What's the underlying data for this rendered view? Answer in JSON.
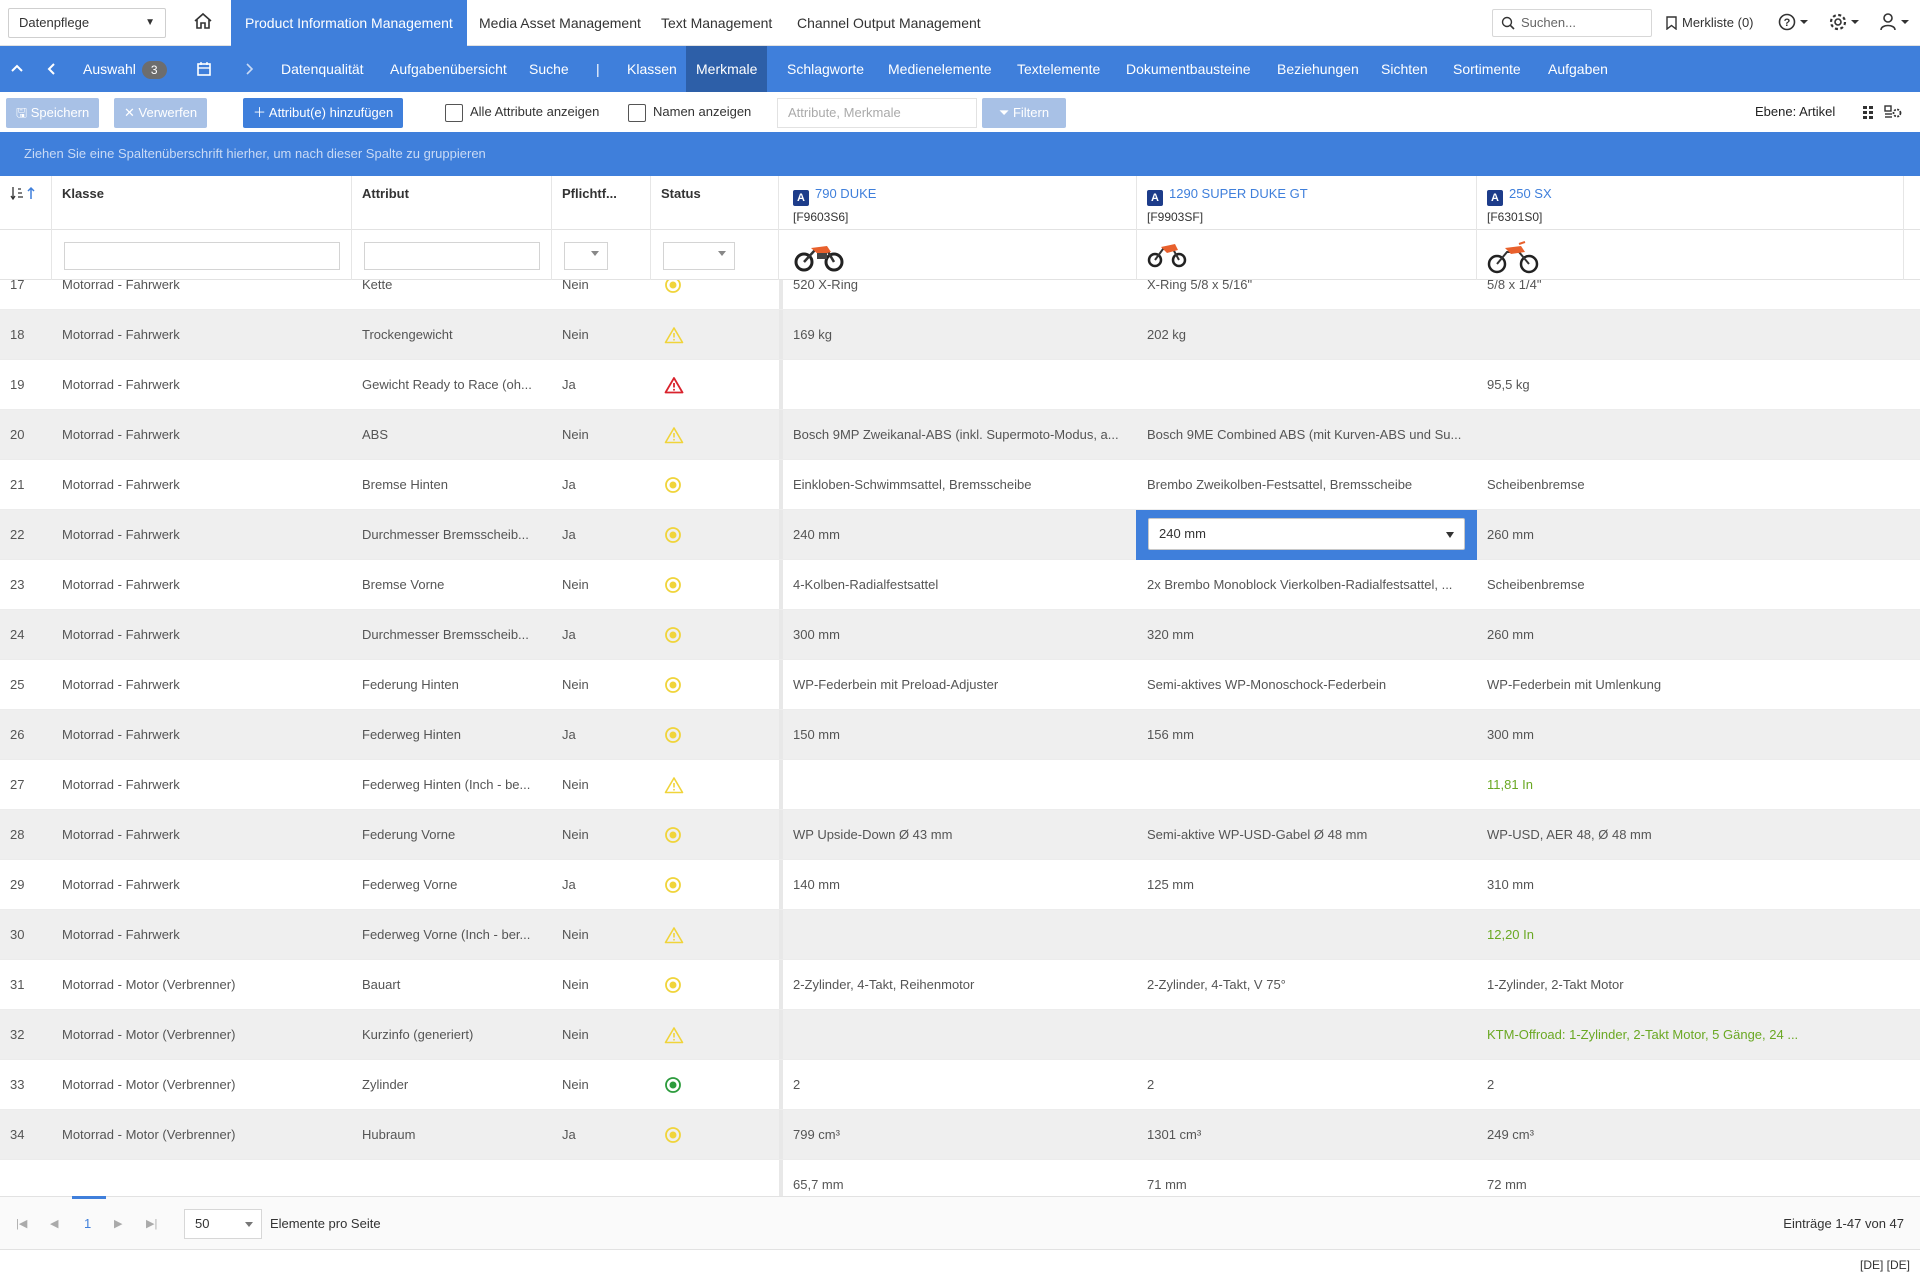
{
  "topbar": {
    "context": "Datenpflege",
    "apps": [
      {
        "label": "Product Information Management",
        "active": true
      },
      {
        "label": "Media Asset Management",
        "active": false
      },
      {
        "label": "Text Management",
        "active": false
      },
      {
        "label": "Channel Output Management",
        "active": false
      }
    ],
    "search_placeholder": "Suchen...",
    "merkliste": "Merkliste (0)"
  },
  "nav": {
    "auswahl": "Auswahl",
    "auswahl_count": "3",
    "items": [
      "Datenqualität",
      "Aufgabenübersicht",
      "Suche",
      "|",
      "Klassen",
      "Merkmale",
      "Schlagworte",
      "Medienelemente",
      "Textelemente",
      "Dokumentbausteine",
      "Beziehungen",
      "Sichten",
      "Sortimente",
      "Aufgaben"
    ],
    "active": "Merkmale"
  },
  "toolbar": {
    "save": "Speichern",
    "discard": "Verwerfen",
    "add_attr": "Attribut(e) hinzufügen",
    "show_all": "Alle Attribute anzeigen",
    "show_names": "Namen anzeigen",
    "filter_placeholder": "Attribute, Merkmale",
    "filter_btn": "Filtern",
    "ebene": "Ebene: Artikel"
  },
  "groupbar": "Ziehen Sie eine Spaltenüberschrift hierher, um nach dieser Spalte zu gruppieren",
  "grid": {
    "headers": {
      "klasse": "Klasse",
      "attribut": "Attribut",
      "pflicht": "Pflichtf...",
      "status": "Status"
    },
    "products": [
      {
        "badge": "A",
        "name": "790 DUKE",
        "code": "[F9603S6]"
      },
      {
        "badge": "A",
        "name": "1290 SUPER DUKE GT",
        "code": "[F9903SF]"
      },
      {
        "badge": "A",
        "name": "250 SX",
        "code": "[F6301S0]"
      }
    ],
    "rows": [
      {
        "n": "17",
        "klasse": "Motorrad - Fahrwerk",
        "attr": "Kette",
        "pf": "Nein",
        "status": "circle-yellow",
        "v1": "520 X-Ring",
        "v2": "X-Ring 5/8 x 5/16\"",
        "v3": "5/8 x 1/4\""
      },
      {
        "n": "18",
        "klasse": "Motorrad - Fahrwerk",
        "attr": "Trockengewicht",
        "pf": "Nein",
        "status": "warn-yellow",
        "v1": "169 kg",
        "v2": "202 kg",
        "v3": ""
      },
      {
        "n": "19",
        "klasse": "Motorrad - Fahrwerk",
        "attr": "Gewicht Ready to Race (oh...",
        "pf": "Ja",
        "status": "warn-red",
        "v1": "",
        "v2": "",
        "v3": "95,5 kg"
      },
      {
        "n": "20",
        "klasse": "Motorrad - Fahrwerk",
        "attr": "ABS",
        "pf": "Nein",
        "status": "warn-yellow",
        "v1": "Bosch 9MP Zweikanal-ABS (inkl. Supermoto-Modus, a...",
        "v2": "Bosch 9ME Combined ABS (mit Kurven-ABS und Su...",
        "v3": ""
      },
      {
        "n": "21",
        "klasse": "Motorrad - Fahrwerk",
        "attr": "Bremse Hinten",
        "pf": "Ja",
        "status": "circle-yellow",
        "v1": "Einkloben-Schwimmsattel, Bremsscheibe",
        "v2": "Brembo Zweikolben-Festsattel, Bremsscheibe",
        "v3": "Scheibenbremse"
      },
      {
        "n": "22",
        "klasse": "Motorrad - Fahrwerk",
        "attr": "Durchmesser Bremsscheib...",
        "pf": "Ja",
        "status": "circle-yellow",
        "v1": "240 mm",
        "v2": "240 mm",
        "v3": "260 mm",
        "editing": true
      },
      {
        "n": "23",
        "klasse": "Motorrad - Fahrwerk",
        "attr": "Bremse Vorne",
        "pf": "Nein",
        "status": "circle-yellow",
        "v1": "4-Kolben-Radialfestsattel",
        "v2": "2x Brembo Monoblock Vierkolben-Radialfestsattel, ...",
        "v3": "Scheibenbremse"
      },
      {
        "n": "24",
        "klasse": "Motorrad - Fahrwerk",
        "attr": "Durchmesser Bremsscheib...",
        "pf": "Ja",
        "status": "circle-yellow",
        "v1": "300 mm",
        "v2": "320 mm",
        "v3": "260 mm"
      },
      {
        "n": "25",
        "klasse": "Motorrad - Fahrwerk",
        "attr": "Federung Hinten",
        "pf": "Nein",
        "status": "circle-yellow",
        "v1": "WP-Federbein mit Preload-Adjuster",
        "v2": "Semi-aktives WP-Monoschock-Federbein",
        "v3": "WP-Federbein mit Umlenkung"
      },
      {
        "n": "26",
        "klasse": "Motorrad - Fahrwerk",
        "attr": "Federweg Hinten",
        "pf": "Ja",
        "status": "circle-yellow",
        "v1": "150 mm",
        "v2": "156 mm",
        "v3": "300 mm"
      },
      {
        "n": "27",
        "klasse": "Motorrad - Fahrwerk",
        "attr": "Federweg Hinten (Inch - be...",
        "pf": "Nein",
        "status": "warn-yellow",
        "v1": "",
        "v2": "",
        "v3": "11,81 In",
        "v3green": true
      },
      {
        "n": "28",
        "klasse": "Motorrad - Fahrwerk",
        "attr": "Federung Vorne",
        "pf": "Nein",
        "status": "circle-yellow",
        "v1": "WP Upside-Down Ø 43 mm",
        "v2": "Semi-aktive WP-USD-Gabel Ø 48 mm",
        "v3": "WP-USD, AER 48, Ø 48 mm"
      },
      {
        "n": "29",
        "klasse": "Motorrad - Fahrwerk",
        "attr": "Federweg Vorne",
        "pf": "Ja",
        "status": "circle-yellow",
        "v1": "140 mm",
        "v2": "125 mm",
        "v3": "310 mm"
      },
      {
        "n": "30",
        "klasse": "Motorrad - Fahrwerk",
        "attr": "Federweg Vorne (Inch - ber...",
        "pf": "Nein",
        "status": "warn-yellow",
        "v1": "",
        "v2": "",
        "v3": "12,20 In",
        "v3green": true
      },
      {
        "n": "31",
        "klasse": "Motorrad - Motor (Verbrenner)",
        "attr": "Bauart",
        "pf": "Nein",
        "status": "circle-yellow",
        "v1": "2-Zylinder, 4-Takt, Reihenmotor",
        "v2": "2-Zylinder, 4-Takt, V 75°",
        "v3": "1-Zylinder, 2-Takt Motor"
      },
      {
        "n": "32",
        "klasse": "Motorrad - Motor (Verbrenner)",
        "attr": "Kurzinfo (generiert)",
        "pf": "Nein",
        "status": "warn-yellow",
        "v1": "",
        "v2": "",
        "v3": "KTM-Offroad: 1-Zylinder, 2-Takt Motor, 5 Gänge, 24 ...",
        "v3green": true
      },
      {
        "n": "33",
        "klasse": "Motorrad - Motor (Verbrenner)",
        "attr": "Zylinder",
        "pf": "Nein",
        "status": "circle-green",
        "v1": "2",
        "v2": "2",
        "v3": "2"
      },
      {
        "n": "34",
        "klasse": "Motorrad - Motor (Verbrenner)",
        "attr": "Hubraum",
        "pf": "Ja",
        "status": "circle-yellow",
        "v1": "799 cm³",
        "v2": "1301 cm³",
        "v3": "249 cm³"
      },
      {
        "n": "",
        "klasse": "",
        "attr": "",
        "pf": "",
        "status": "",
        "v1": "65,7 mm",
        "v2": "71 mm",
        "v3": "72 mm"
      }
    ]
  },
  "pager": {
    "page": "1",
    "page_size": "50",
    "label": "Elemente pro Seite",
    "count": "Einträge 1-47 von 47"
  },
  "statusbar": {
    "lang": "[DE] [DE]"
  },
  "colors": {
    "accent": "#3f7fdb",
    "accent_dark": "#2d5fa8",
    "status_yellow": "#f0d43a",
    "status_red": "#d9232d",
    "status_green": "#2c9b3c",
    "value_green": "#6aa823"
  }
}
